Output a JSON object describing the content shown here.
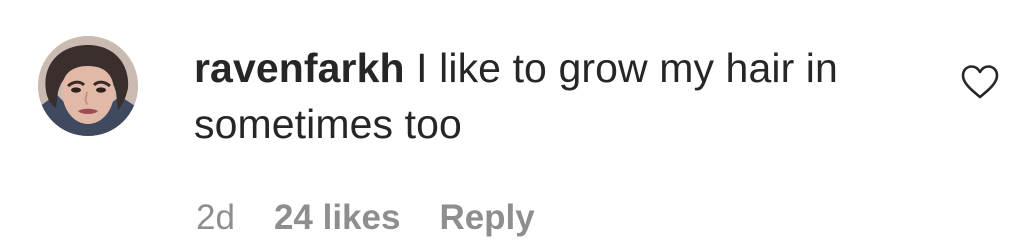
{
  "comment": {
    "username": "ravenfarkh",
    "text": "I like to grow my hair in sometimes too",
    "avatar_icon": "user-avatar-photo",
    "like_icon": "heart-outline-icon",
    "timestamp": "2d",
    "likes_label": "24 likes",
    "reply_label": "Reply"
  },
  "colors": {
    "text": "#262626",
    "meta": "#8e8e8e",
    "background": "#ffffff"
  }
}
